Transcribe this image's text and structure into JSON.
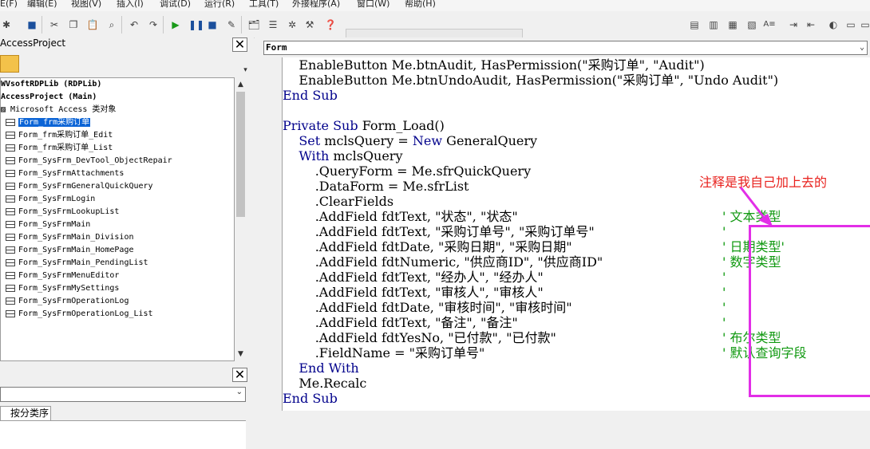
{
  "menu": [
    "E(F)",
    "编辑(E)",
    "视图(V)",
    "插入(I)",
    "调试(D)",
    "运行(R)",
    "工具(T)",
    "外接程序(A)",
    "窗口(W)",
    "帮助(H)"
  ],
  "project": {
    "title": "AccessProject",
    "root": "WVsoftRDPLib (RDPLib)",
    "access_project": "AccessProject (Main)",
    "category": "Microsoft Access 类对象",
    "items": [
      "Form_frm采购订单",
      "Form_frm采购订单_Edit",
      "Form_frm采购订单_List",
      "Form_SysFrm_DevTool_ObjectRepair",
      "Form_SysFrmAttachments",
      "Form_SysFrmGeneralQuickQuery",
      "Form_SysFrmLogin",
      "Form_SysFrmLookupList",
      "Form_SysFrmMain",
      "Form_SysFrmMain_Division",
      "Form_SysFrmMain_HomePage",
      "Form_SysFrmMain_PendingList",
      "Form_SysFrmMenuEditor",
      "Form_SysFrmMySettings",
      "Form_SysFrmOperationLog",
      "Form_SysFrmOperationLog_List"
    ],
    "selected_index": 0
  },
  "properties": {
    "tab_label": "按分类序"
  },
  "code": {
    "object_combo": "Form",
    "lines": [
      [
        {
          "t": "    EnableButton Me.btnAudit, HasPermission(\"采购订单\", \"Audit\")"
        }
      ],
      [
        {
          "t": "    EnableButton Me.btnUndoAudit, HasPermission(\"采购订单\", \"Undo Audit\")"
        }
      ],
      [
        {
          "t": "End Sub",
          "k": true
        }
      ],
      [
        {
          "t": ""
        }
      ],
      [
        {
          "t": "Private Sub ",
          "k": true
        },
        {
          "t": "Form_Load()"
        }
      ],
      [
        {
          "t": "    "
        },
        {
          "t": "Set ",
          "k": true
        },
        {
          "t": "mclsQuery = "
        },
        {
          "t": "New ",
          "k": true
        },
        {
          "t": "GeneralQuery"
        }
      ],
      [
        {
          "t": "    "
        },
        {
          "t": "With ",
          "k": true
        },
        {
          "t": "mclsQuery"
        }
      ],
      [
        {
          "t": "        .QueryForm = Me.sfrQuickQuery"
        }
      ],
      [
        {
          "t": "        .DataForm = Me.sfrList"
        }
      ],
      [
        {
          "t": "        .ClearFields"
        }
      ],
      [
        {
          "t": "        .AddField fdtText, \"状态\", \"状态\""
        }
      ],
      [
        {
          "t": "        .AddField fdtText, \"采购订单号\", \"采购订单号\""
        }
      ],
      [
        {
          "t": "        .AddField fdtDate, \"采购日期\", \"采购日期\""
        }
      ],
      [
        {
          "t": "        .AddField fdtNumeric, \"供应商ID\", \"供应商ID\""
        }
      ],
      [
        {
          "t": "        .AddField fdtText, \"经办人\", \"经办人\""
        }
      ],
      [
        {
          "t": "        .AddField fdtText, \"审核人\", \"审核人\""
        }
      ],
      [
        {
          "t": "        .AddField fdtDate, \"审核时间\", \"审核时间\""
        }
      ],
      [
        {
          "t": "        .AddField fdtText, \"备注\", \"备注\""
        }
      ],
      [
        {
          "t": "        .AddField fdtYesNo, \"已付款\", \"已付款\""
        }
      ],
      [
        {
          "t": "        .FieldName = \"采购订单号\""
        }
      ],
      [
        {
          "t": "    "
        },
        {
          "t": "End With",
          "k": true
        }
      ],
      [
        {
          "t": "    Me.Recalc"
        }
      ],
      [
        {
          "t": "End Sub",
          "k": true
        }
      ]
    ],
    "comments": [
      {
        "line": 10,
        "text": "' 文本类型"
      },
      {
        "line": 11,
        "text": "'"
      },
      {
        "line": 12,
        "text": "' 日期类型'"
      },
      {
        "line": 13,
        "text": "' 数字类型"
      },
      {
        "line": 14,
        "text": "'"
      },
      {
        "line": 15,
        "text": "'"
      },
      {
        "line": 16,
        "text": "'"
      },
      {
        "line": 17,
        "text": "'"
      },
      {
        "line": 18,
        "text": "' 布尔类型"
      },
      {
        "line": 19,
        "text": "' 默认查询字段"
      }
    ],
    "annotation": "注释是我自己加上去的"
  },
  "colors": {
    "keyword": "#00008b",
    "comment": "#119911",
    "annotation": "#e8211d",
    "highlight_box": "#e22ee7",
    "selection": "#0b64d6"
  }
}
